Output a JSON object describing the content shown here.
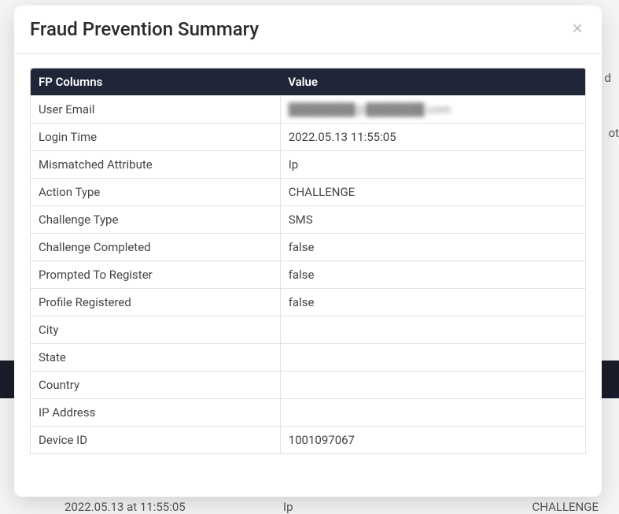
{
  "modal": {
    "title": "Fraud Prevention Summary"
  },
  "table": {
    "headers": {
      "col1": "FP Columns",
      "col2": "Value"
    },
    "rows": [
      {
        "label": "User Email",
        "value": "████████@███████.com",
        "blurred": true
      },
      {
        "label": "Login Time",
        "value": "2022.05.13 11:55:05"
      },
      {
        "label": "Mismatched Attribute",
        "value": "Ip"
      },
      {
        "label": "Action Type",
        "value": "CHALLENGE"
      },
      {
        "label": "Challenge Type",
        "value": "SMS"
      },
      {
        "label": "Challenge Completed",
        "value": "false"
      },
      {
        "label": "Prompted To Register",
        "value": "false"
      },
      {
        "label": "Profile Registered",
        "value": "false"
      },
      {
        "label": "City",
        "value": ""
      },
      {
        "label": "State",
        "value": ""
      },
      {
        "label": "Country",
        "value": ""
      },
      {
        "label": "IP Address",
        "value": ""
      },
      {
        "label": "Device ID",
        "value": "1001097067"
      }
    ]
  },
  "background": {
    "partial_d": "d",
    "partial_ote": "ote",
    "time": "2022.05.13 at 11:55:05",
    "ip": "Ip",
    "challenge": "CHALLENGE"
  }
}
